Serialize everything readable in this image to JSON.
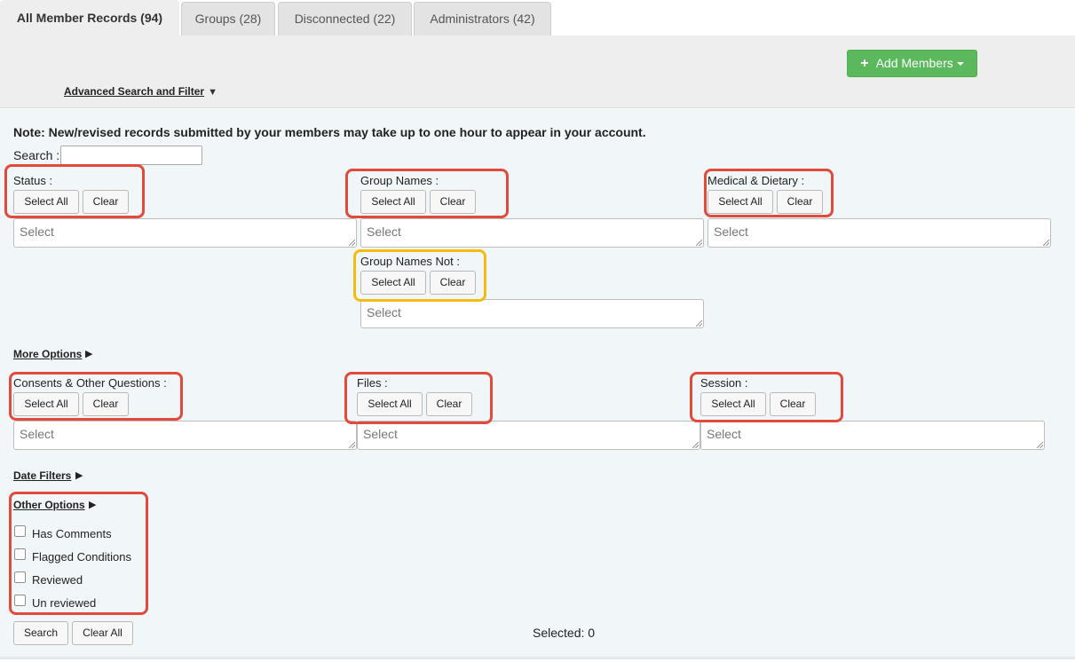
{
  "tabs": [
    {
      "label": "All Member Records (94)"
    },
    {
      "label": "Groups (28)"
    },
    {
      "label": "Disconnected (22)"
    },
    {
      "label": "Administrators (42)"
    }
  ],
  "header": {
    "add_members_label": "Add Members",
    "advanced_search_label": "Advanced Search and Filter",
    "advanced_search_arrow": "▼"
  },
  "note": "Note: New/revised records submitted by your members may take up to one hour to appear in your account.",
  "search": {
    "label": "Search :",
    "value": ""
  },
  "common": {
    "select_all": "Select All",
    "clear": "Clear",
    "select_placeholder": "Select"
  },
  "filters": {
    "status": "Status :",
    "group_names": "Group Names :",
    "medical_dietary": "Medical & Dietary :",
    "group_names_not": "Group Names Not :",
    "consents": "Consents & Other Questions :",
    "files": "Files :",
    "session": "Session :"
  },
  "sections": {
    "more_options": "More Options",
    "date_filters": "Date Filters",
    "other_options": "Other Options",
    "arrow_right": "▶"
  },
  "other_options": [
    {
      "label": "Has Comments",
      "checked": false
    },
    {
      "label": "Flagged Conditions",
      "checked": false
    },
    {
      "label": "Reviewed",
      "checked": false
    },
    {
      "label": "Un reviewed",
      "checked": false
    }
  ],
  "footer": {
    "search_label": "Search",
    "clear_all_label": "Clear All",
    "selected_text": "Selected: 0"
  },
  "colors": {
    "accent_green": "#5cb85c",
    "highlight_red": "#e14b3b",
    "highlight_yellow": "#f5bb10"
  }
}
